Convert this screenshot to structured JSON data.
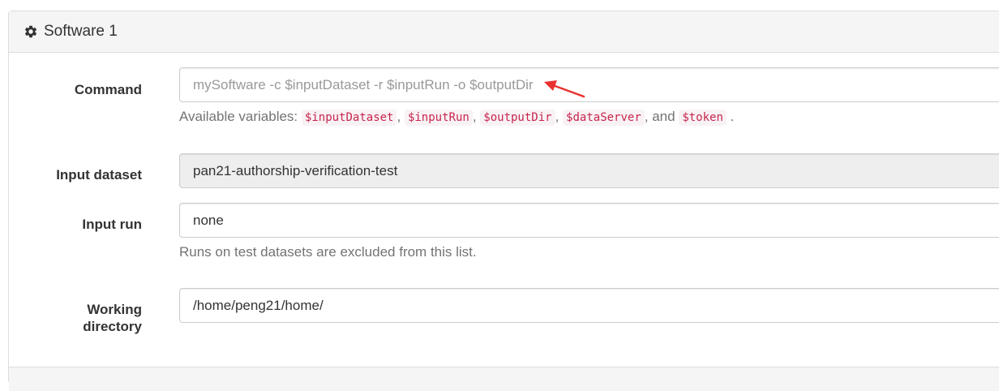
{
  "panel": {
    "title": "Software 1",
    "title_icon": "gear-icon"
  },
  "form": {
    "command": {
      "label": "Command",
      "placeholder": "mySoftware -c $inputDataset -r $inputRun -o $outputDir",
      "value": "",
      "help_prefix": "Available variables:",
      "variables": [
        "$inputDataset",
        "$inputRun",
        "$outputDir",
        "$dataServer",
        "$token"
      ],
      "separator": ",",
      "and_text": ", and",
      "end_text": "."
    },
    "input_dataset": {
      "label": "Input dataset",
      "value": "pan21-authorship-verification-test"
    },
    "input_run": {
      "label": "Input run",
      "selected": "none",
      "help": "Runs on test datasets are excluded from this list."
    },
    "working_directory": {
      "label_line1": "Working",
      "label_line2": "directory",
      "value": "/home/peng21/home/"
    }
  },
  "annotation": {
    "arrow_color": "#e8322f"
  }
}
